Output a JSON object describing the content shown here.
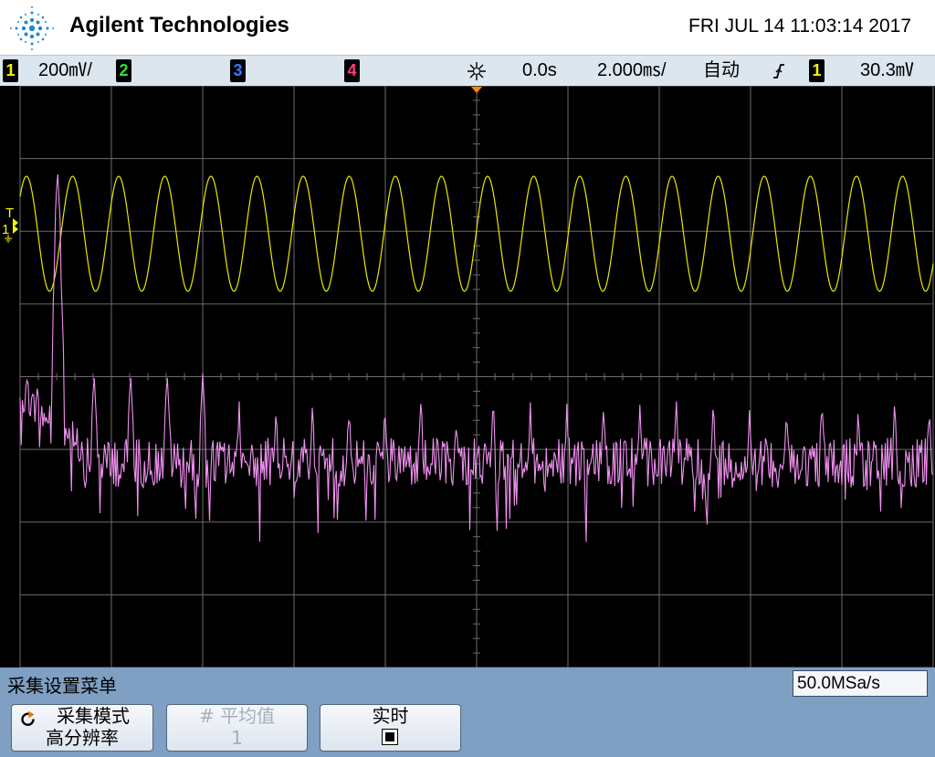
{
  "header": {
    "brand": "Agilent Technologies",
    "datetime": "FRI JUL 14 11:03:14 2017"
  },
  "status_bar": {
    "ch1": {
      "label": "1",
      "scale": "200㎷/",
      "color": "#f5f500"
    },
    "ch2": {
      "label": "2",
      "color": "#2ee32e"
    },
    "ch3": {
      "label": "3",
      "color": "#3a7bff"
    },
    "ch4": {
      "label": "4",
      "color": "#ff3c7a"
    },
    "delay": "0.0s",
    "timebase": "2.000㎳/",
    "trigger_mode": "自动",
    "trigger_slope_icon": "rising-edge-icon",
    "trigger_source": "1",
    "trigger_level": "30.3㎷"
  },
  "screen": {
    "trigger_marker": "T",
    "ch1_marker": "1",
    "trace1_color": "#e8e800",
    "trace_math_color": "#f090f0"
  },
  "menu": {
    "title": "采集设置菜单",
    "sample_rate": "50.0MSa/s",
    "softkeys": {
      "acq_mode": {
        "line1": "采集模式",
        "line2": "高分辨率"
      },
      "averages": {
        "line1": "# 平均值",
        "line2": "1"
      },
      "realtime": {
        "line1": "实时"
      }
    }
  }
}
